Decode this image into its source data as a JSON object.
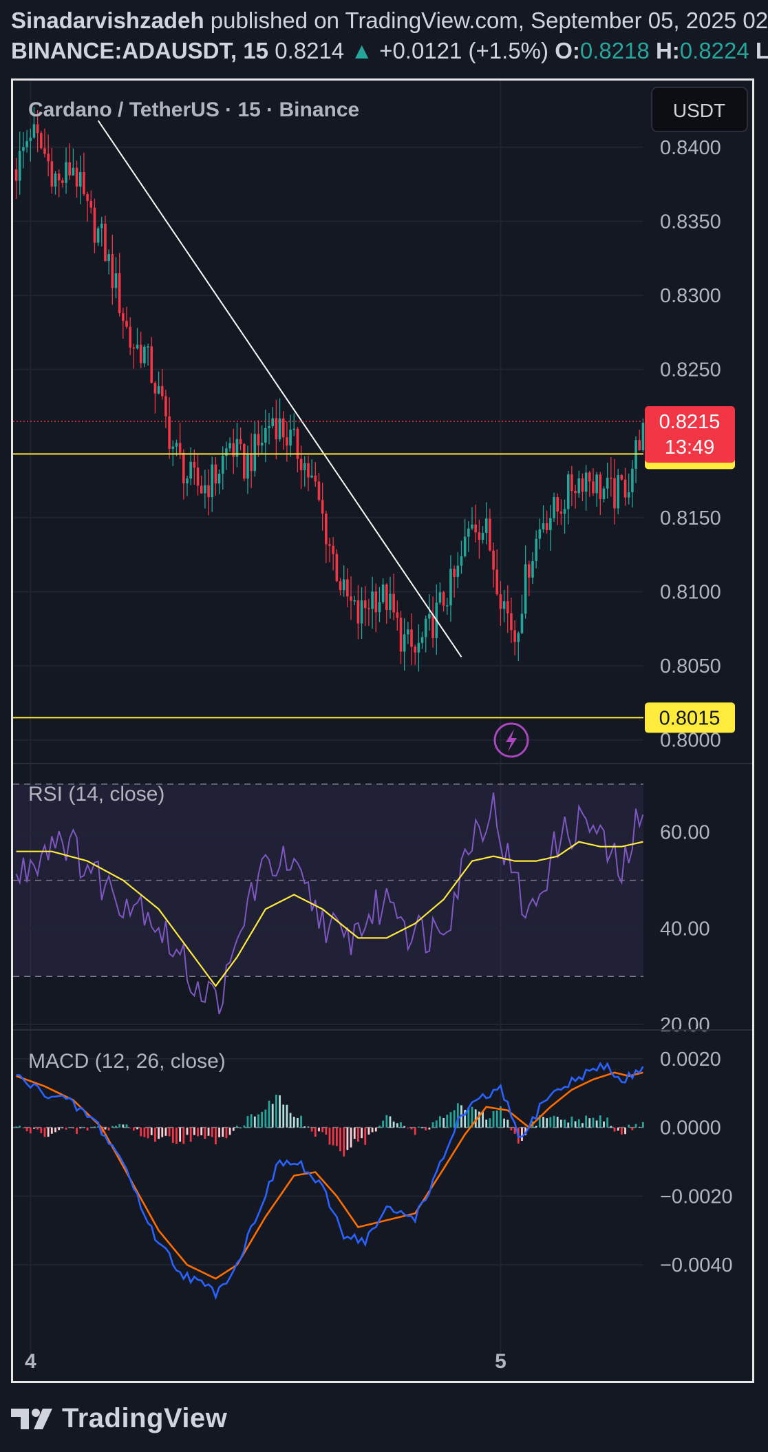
{
  "header": {
    "author": "Sinadarvishzadeh",
    "published_text": "published on TradingView.com, September 05, 2025 02",
    "symbol": "BINANCE:ADAUSDT, 15",
    "last_price": "0.8214",
    "change": "+0.0121 (+1.5%)",
    "open_label": "O:",
    "open_value": "0.8218",
    "high_label": "H:",
    "high_value": "0.8224",
    "low_label": "L"
  },
  "chart_title": "Cardano / TetherUS · 15 · Binance",
  "currency_button": "USDT",
  "price_badge": {
    "price": "0.8215",
    "countdown": "13:49",
    "color": "#f23645"
  },
  "level_labels": [
    "0.8193",
    "0.8015"
  ],
  "x_labels": [
    "4",
    "5"
  ],
  "rsi_label": "RSI (14, close)",
  "macd_label": "MACD (12, 26, close)",
  "footer": {
    "brand": "TradingView"
  },
  "colors": {
    "up": "#26a69a",
    "down": "#f23645",
    "level": "#ffeb3b",
    "rsi": "#7e57c2",
    "rsi_ma": "#ffeb3b",
    "macd": "#2962ff",
    "signal": "#ff6d00"
  },
  "icons": {
    "lightning": "lightning-icon"
  },
  "chart_data": [
    {
      "type": "candlestick",
      "title": "Cardano / TetherUS · 15 · Binance",
      "ylim": [
        0.7985,
        0.8445
      ],
      "y_ticks": [
        "0.8000",
        "0.8050",
        "0.8100",
        "0.8150",
        "0.8250",
        "0.8300",
        "0.8350",
        "0.8400"
      ],
      "close_path": [
        [
          0,
          0.8385
        ],
        [
          4,
          0.8412
        ],
        [
          8,
          0.8395
        ],
        [
          12,
          0.8375
        ],
        [
          16,
          0.8388
        ],
        [
          20,
          0.8355
        ],
        [
          24,
          0.8338
        ],
        [
          28,
          0.8305
        ],
        [
          32,
          0.8268
        ],
        [
          36,
          0.8262
        ],
        [
          40,
          0.8232
        ],
        [
          44,
          0.8198
        ],
        [
          48,
          0.8178
        ],
        [
          52,
          0.817
        ],
        [
          56,
          0.8178
        ],
        [
          60,
          0.82
        ],
        [
          64,
          0.8185
        ],
        [
          68,
          0.8198
        ],
        [
          72,
          0.8218
        ],
        [
          76,
          0.8205
        ],
        [
          80,
          0.8192
        ],
        [
          84,
          0.8168
        ],
        [
          88,
          0.8132
        ],
        [
          92,
          0.8098
        ],
        [
          96,
          0.8082
        ],
        [
          100,
          0.8098
        ],
        [
          104,
          0.8095
        ],
        [
          108,
          0.807
        ],
        [
          112,
          0.8058
        ],
        [
          116,
          0.8075
        ],
        [
          120,
          0.8095
        ],
        [
          124,
          0.8112
        ],
        [
          128,
          0.815
        ],
        [
          132,
          0.814
        ],
        [
          136,
          0.81
        ],
        [
          140,
          0.807
        ],
        [
          144,
          0.812
        ],
        [
          148,
          0.815
        ],
        [
          152,
          0.8155
        ],
        [
          156,
          0.8172
        ],
        [
          160,
          0.818
        ],
        [
          164,
          0.817
        ],
        [
          168,
          0.8165
        ],
        [
          172,
          0.8175
        ],
        [
          176,
          0.8215
        ]
      ],
      "candle_count": 177,
      "last_close": 0.8214,
      "levels": [
        0.8193,
        0.8015
      ],
      "current_price": 0.8215,
      "trendline": [
        [
          23,
          0.8418
        ],
        [
          125,
          0.8056
        ]
      ]
    },
    {
      "type": "line",
      "title": "RSI (14, close)",
      "ylim": [
        19,
        74
      ],
      "y_ticks": [
        "20.00",
        "40.00",
        "60.00"
      ],
      "bands": [
        30,
        50,
        70
      ],
      "series": [
        {
          "name": "RSI",
          "path": [
            [
              0,
              50
            ],
            [
              8,
              57
            ],
            [
              12,
              60
            ],
            [
              20,
              53
            ],
            [
              28,
              47
            ],
            [
              36,
              45
            ],
            [
              44,
              36
            ],
            [
              50,
              29
            ],
            [
              56,
              25
            ],
            [
              60,
              30
            ],
            [
              66,
              48
            ],
            [
              72,
              54
            ],
            [
              76,
              53
            ],
            [
              80,
              49
            ],
            [
              84,
              44
            ],
            [
              92,
              37
            ],
            [
              100,
              43
            ],
            [
              106,
              47
            ],
            [
              110,
              40
            ],
            [
              116,
              39
            ],
            [
              122,
              44
            ],
            [
              128,
              60
            ],
            [
              134,
              65
            ],
            [
              138,
              54
            ],
            [
              144,
              42
            ],
            [
              148,
              50
            ],
            [
              152,
              58
            ],
            [
              160,
              63
            ],
            [
              166,
              56
            ],
            [
              170,
              51
            ],
            [
              174,
              61
            ],
            [
              176,
              62
            ]
          ]
        },
        {
          "name": "RSI MA",
          "path": [
            [
              0,
              56
            ],
            [
              10,
              56
            ],
            [
              20,
              54
            ],
            [
              30,
              50
            ],
            [
              40,
              44
            ],
            [
              50,
              34
            ],
            [
              56,
              28
            ],
            [
              62,
              34
            ],
            [
              70,
              44
            ],
            [
              78,
              47
            ],
            [
              86,
              44
            ],
            [
              96,
              38
            ],
            [
              104,
              38
            ],
            [
              112,
              41
            ],
            [
              120,
              46
            ],
            [
              128,
              54
            ],
            [
              134,
              55
            ],
            [
              140,
              54
            ],
            [
              146,
              54
            ],
            [
              152,
              55
            ],
            [
              158,
              58
            ],
            [
              164,
              57
            ],
            [
              170,
              57
            ],
            [
              176,
              58
            ]
          ]
        }
      ]
    },
    {
      "type": "line",
      "title": "MACD (12, 26, close)",
      "ylim": [
        -0.006,
        0.0028
      ],
      "y_ticks": [
        "0.0020",
        "0.0000",
        "−0.0020",
        "−0.0040"
      ],
      "series": [
        {
          "name": "MACD",
          "path": [
            [
              0,
              0.0015
            ],
            [
              6,
              0.0011
            ],
            [
              14,
              0.0008
            ],
            [
              22,
              0.0002
            ],
            [
              30,
              -0.001
            ],
            [
              38,
              -0.003
            ],
            [
              46,
              -0.0042
            ],
            [
              56,
              -0.0048
            ],
            [
              62,
              -0.004
            ],
            [
              68,
              -0.0024
            ],
            [
              74,
              -0.001
            ],
            [
              80,
              -0.0011
            ],
            [
              86,
              -0.0018
            ],
            [
              92,
              -0.0031
            ],
            [
              98,
              -0.0033
            ],
            [
              104,
              -0.0024
            ],
            [
              112,
              -0.0026
            ],
            [
              118,
              -0.0014
            ],
            [
              124,
              0.0002
            ],
            [
              130,
              0.0008
            ],
            [
              136,
              0.0011
            ],
            [
              142,
              -0.0004
            ],
            [
              148,
              0.0008
            ],
            [
              154,
              0.0012
            ],
            [
              160,
              0.0016
            ],
            [
              166,
              0.0018
            ],
            [
              170,
              0.0013
            ],
            [
              176,
              0.0018
            ]
          ]
        },
        {
          "name": "Signal",
          "path": [
            [
              0,
              0.0015
            ],
            [
              8,
              0.0012
            ],
            [
              16,
              0.0008
            ],
            [
              24,
              0.0
            ],
            [
              32,
              -0.0015
            ],
            [
              40,
              -0.003
            ],
            [
              48,
              -0.004
            ],
            [
              56,
              -0.0044
            ],
            [
              62,
              -0.004
            ],
            [
              70,
              -0.0026
            ],
            [
              78,
              -0.0014
            ],
            [
              84,
              -0.0013
            ],
            [
              90,
              -0.002
            ],
            [
              96,
              -0.0029
            ],
            [
              104,
              -0.0027
            ],
            [
              112,
              -0.0025
            ],
            [
              120,
              -0.0012
            ],
            [
              126,
              -0.0002
            ],
            [
              132,
              0.0006
            ],
            [
              138,
              0.0005
            ],
            [
              144,
              0.0
            ],
            [
              150,
              0.0006
            ],
            [
              156,
              0.0011
            ],
            [
              162,
              0.0014
            ],
            [
              168,
              0.0016
            ],
            [
              172,
              0.0015
            ],
            [
              176,
              0.0016
            ]
          ]
        }
      ],
      "histogram_bars": 177
    }
  ]
}
